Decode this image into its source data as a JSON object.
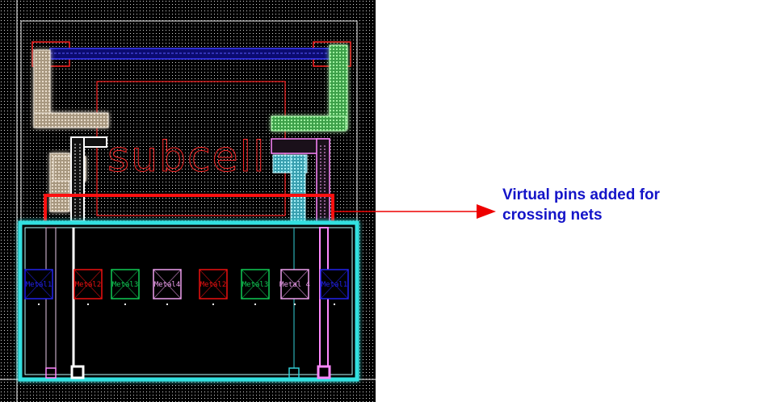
{
  "layout_view": {
    "cell_label": "subcell",
    "pins": [
      {
        "label": "Metal1",
        "color": "#2222ee"
      },
      {
        "label": "Metal2",
        "color": "#ee1111"
      },
      {
        "label": "Metal3",
        "color": "#11cc55"
      },
      {
        "label": "Metal4",
        "color": "#f0a0f0"
      },
      {
        "label": "Metal2",
        "color": "#ee1111"
      },
      {
        "label": "Metal3",
        "color": "#11cc55"
      },
      {
        "label": "Metal 4",
        "color": "#f0a0f0"
      },
      {
        "label": "Metal1",
        "color": "#2222ee"
      }
    ],
    "colors": {
      "background": "#000000",
      "dots": "#d8d8d8",
      "cyan_boundary": "#33e0e0",
      "highlight_box": "#ff1010",
      "callout_arrow": "#ee0000"
    }
  },
  "annotation": {
    "line1": "Virtual pins added for",
    "line2": "crossing nets"
  }
}
